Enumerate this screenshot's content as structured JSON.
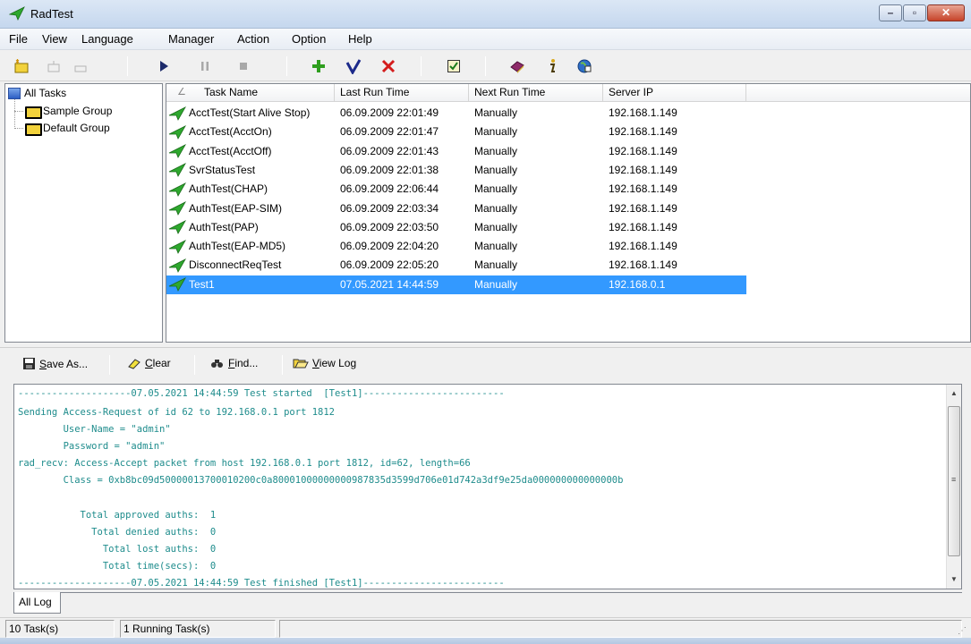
{
  "window": {
    "title": "RadTest"
  },
  "menu": [
    "File",
    "View",
    "Language",
    "Manager",
    "Action",
    "Option",
    "Help"
  ],
  "tree": {
    "root": "All Tasks",
    "groups": [
      "Sample Group",
      "Default Group"
    ]
  },
  "tasks": {
    "columns": [
      "Task Name",
      "Last Run Time",
      "Next Run Time",
      "Server IP"
    ],
    "rows": [
      {
        "name": "AcctTest(Start Alive Stop)",
        "last": "06.09.2009 22:01:49",
        "next": "Manually",
        "ip": "192.168.1.149"
      },
      {
        "name": "AcctTest(AcctOn)",
        "last": "06.09.2009 22:01:47",
        "next": "Manually",
        "ip": "192.168.1.149"
      },
      {
        "name": "AcctTest(AcctOff)",
        "last": "06.09.2009 22:01:43",
        "next": "Manually",
        "ip": "192.168.1.149"
      },
      {
        "name": "SvrStatusTest",
        "last": "06.09.2009 22:01:38",
        "next": "Manually",
        "ip": "192.168.1.149"
      },
      {
        "name": "AuthTest(CHAP)",
        "last": "06.09.2009 22:06:44",
        "next": "Manually",
        "ip": "192.168.1.149"
      },
      {
        "name": "AuthTest(EAP-SIM)",
        "last": "06.09.2009 22:03:34",
        "next": "Manually",
        "ip": "192.168.1.149"
      },
      {
        "name": "AuthTest(PAP)",
        "last": "06.09.2009 22:03:50",
        "next": "Manually",
        "ip": "192.168.1.149"
      },
      {
        "name": "AuthTest(EAP-MD5)",
        "last": "06.09.2009 22:04:20",
        "next": "Manually",
        "ip": "192.168.1.149"
      },
      {
        "name": "DisconnectReqTest",
        "last": "06.09.2009 22:05:20",
        "next": "Manually",
        "ip": "192.168.1.149"
      },
      {
        "name": "Test1",
        "last": "07.05.2021 14:44:59",
        "next": "Manually",
        "ip": "192.168.0.1"
      }
    ]
  },
  "logbar": {
    "save_as_rest": "ave As...",
    "save_as_key": "S",
    "clear_rest": "lear",
    "clear_key": "C",
    "find_rest": "ind...",
    "find_key": "F",
    "viewlog_rest": "iew Log",
    "viewlog_key": "V"
  },
  "log": [
    "--------------------07.05.2021 14:44:59 Test started  [Test1]-------------------------",
    "Sending Access-Request of id 62 to 192.168.0.1 port 1812",
    "        User-Name = \"admin\"",
    "        Password = \"admin\"",
    "rad_recv: Access-Accept packet from host 192.168.0.1 port 1812, id=62, length=66",
    "        Class = 0xb8bc09d50000013700010200c0a80001000000000987835d3599d706e01d742a3df9e25da000000000000000b",
    "",
    "           Total approved auths:  1",
    "             Total denied auths:  0",
    "               Total lost auths:  0",
    "               Total time(secs):  0",
    "--------------------07.05.2021 14:44:59 Test finished [Test1]-------------------------"
  ],
  "tab": "All Log",
  "status": {
    "tasks": "10 Task(s)",
    "running": "1 Running Task(s)"
  },
  "colors": {
    "selection": "#3399ff",
    "log_text": "#1e8c8c",
    "accent_green": "#2e9e1e"
  }
}
